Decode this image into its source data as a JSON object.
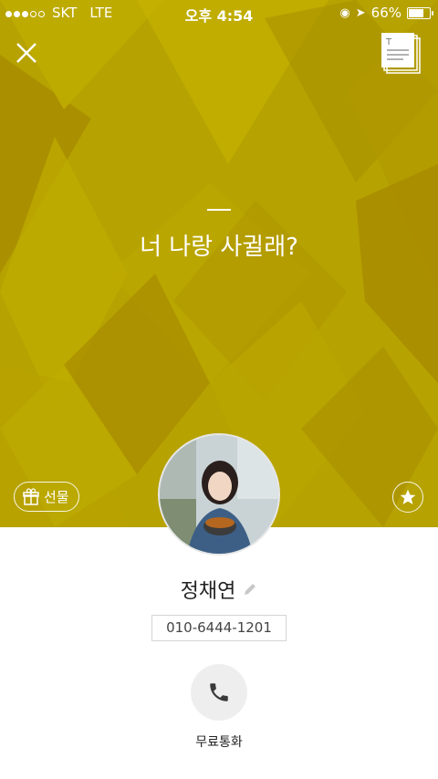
{
  "status_bar": {
    "carrier": "SKT",
    "network": "LTE",
    "time": "오후 4:54",
    "battery": "66%",
    "battery_level": 0.66
  },
  "profile": {
    "status_message": "너 나랑 사귈래?",
    "name": "정채연",
    "phone": "010-6444-1201"
  },
  "actions": {
    "gift_label": "선물",
    "call_label": "무료통화"
  },
  "colors": {
    "cover": "#b8a400",
    "cover_dark": "#a88e00",
    "cover_light": "#c2b100"
  },
  "icons": [
    "close-icon",
    "story-icon",
    "gift-icon",
    "star-icon",
    "edit-pencil-icon",
    "phone-icon"
  ]
}
